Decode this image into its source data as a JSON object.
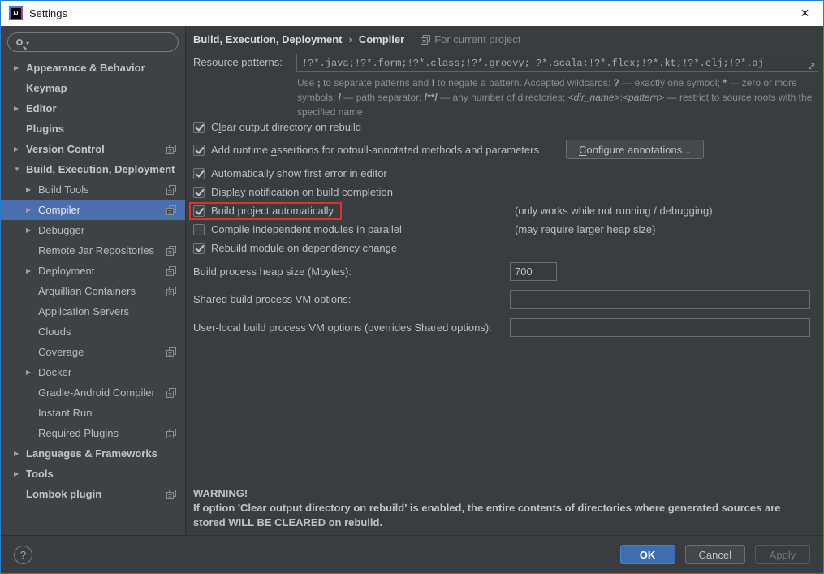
{
  "window": {
    "title": "Settings"
  },
  "icons": {
    "close": "✕",
    "collapsed": "▶",
    "expanded": "▼",
    "search_caret": "▾",
    "logo_text": "IJ"
  },
  "sidebar": {
    "search": {
      "placeholder": ""
    },
    "items": [
      {
        "label": "Appearance & Behavior",
        "level": 0,
        "arrow": "collapsed",
        "bold": true
      },
      {
        "label": "Keymap",
        "level": 0,
        "bold": true
      },
      {
        "label": "Editor",
        "level": 0,
        "arrow": "collapsed",
        "bold": true
      },
      {
        "label": "Plugins",
        "level": 0,
        "bold": true
      },
      {
        "label": "Version Control",
        "level": 0,
        "arrow": "collapsed",
        "bold": true,
        "project_icon": true
      },
      {
        "label": "Build, Execution, Deployment",
        "level": 0,
        "arrow": "expanded",
        "bold": true
      },
      {
        "label": "Build Tools",
        "level": 1,
        "arrow": "collapsed",
        "project_icon": true
      },
      {
        "label": "Compiler",
        "level": 1,
        "arrow": "collapsed",
        "selected": true,
        "project_icon": true
      },
      {
        "label": "Debugger",
        "level": 1,
        "arrow": "collapsed"
      },
      {
        "label": "Remote Jar Repositories",
        "level": 1,
        "project_icon": true
      },
      {
        "label": "Deployment",
        "level": 1,
        "arrow": "collapsed",
        "project_icon": true
      },
      {
        "label": "Arquillian Containers",
        "level": 1,
        "project_icon": true
      },
      {
        "label": "Application Servers",
        "level": 1
      },
      {
        "label": "Clouds",
        "level": 1
      },
      {
        "label": "Coverage",
        "level": 1,
        "project_icon": true
      },
      {
        "label": "Docker",
        "level": 1,
        "arrow": "collapsed"
      },
      {
        "label": "Gradle-Android Compiler",
        "level": 1,
        "project_icon": true
      },
      {
        "label": "Instant Run",
        "level": 1
      },
      {
        "label": "Required Plugins",
        "level": 1,
        "project_icon": true
      },
      {
        "label": "Languages & Frameworks",
        "level": 0,
        "arrow": "collapsed",
        "bold": true
      },
      {
        "label": "Tools",
        "level": 0,
        "arrow": "collapsed",
        "bold": true
      },
      {
        "label": "Lombok plugin",
        "level": 0,
        "bold": true,
        "project_icon": true
      }
    ]
  },
  "main": {
    "breadcrumb": {
      "parent": "Build, Execution, Deployment",
      "separator": "›",
      "child": "Compiler",
      "scope": "For current project"
    },
    "resource_patterns": {
      "label": "Resource patterns:",
      "value": "!?*.java;!?*.form;!?*.class;!?*.groovy;!?*.scala;!?*.flex;!?*.kt;!?*.clj;!?*.aj"
    },
    "hint": [
      {
        "t": "Use "
      },
      {
        "t": ";",
        "b": true
      },
      {
        "t": " to separate patterns and "
      },
      {
        "t": "!",
        "b": true
      },
      {
        "t": " to negate a pattern. Accepted wildcards: "
      },
      {
        "t": "?",
        "b": true
      },
      {
        "t": " — exactly one symbol; "
      },
      {
        "t": "*",
        "b": true
      },
      {
        "t": " — zero or more symbols; "
      },
      {
        "t": "/",
        "b": true
      },
      {
        "t": " — path separator; "
      },
      {
        "t": "/**/",
        "b": true
      },
      {
        "t": " — any number of directories; "
      },
      {
        "t": "<dir_name>",
        "i": true
      },
      {
        "t": ":"
      },
      {
        "t": "<pattern>",
        "i": true
      },
      {
        "t": " — restrict to source roots with the specified name"
      }
    ],
    "checkboxes": [
      {
        "label": "Clear output directory on rebuild",
        "checked": true,
        "mnemonic_index": 1
      },
      {
        "label": "Add runtime assertions for notnull-annotated methods and parameters",
        "checked": true,
        "mnemonic_index": 12,
        "button": "Configure annotations...",
        "button_mnemonic_index": 0
      },
      {
        "label": "Automatically show first error in editor",
        "checked": true,
        "mnemonic_index": 25
      },
      {
        "label": "Display notification on build completion",
        "checked": true
      },
      {
        "label": "Build project automatically",
        "checked": true,
        "highlighted": true,
        "note": "(only works while not running / debugging)"
      },
      {
        "label": "Compile independent modules in parallel",
        "checked": false,
        "note": "(may require larger heap size)"
      },
      {
        "label": "Rebuild module on dependency change",
        "checked": true
      }
    ],
    "fields": [
      {
        "name": "build-process-heap-size",
        "label": "Build process heap size (Mbytes):",
        "value": "700",
        "small": true
      },
      {
        "name": "shared-vm-options",
        "label": "Shared build process VM options:",
        "value": ""
      },
      {
        "name": "user-local-vm-options",
        "label": "User-local build process VM options (overrides Shared options):",
        "value": ""
      }
    ],
    "warning": {
      "lines": [
        "WARNING!",
        "If option 'Clear output directory on rebuild' is enabled, the entire contents of directories where generated sources are",
        "stored WILL BE CLEARED on rebuild."
      ]
    }
  },
  "footer": {
    "help": "?",
    "ok": "OK",
    "cancel": "Cancel",
    "apply": "Apply"
  }
}
